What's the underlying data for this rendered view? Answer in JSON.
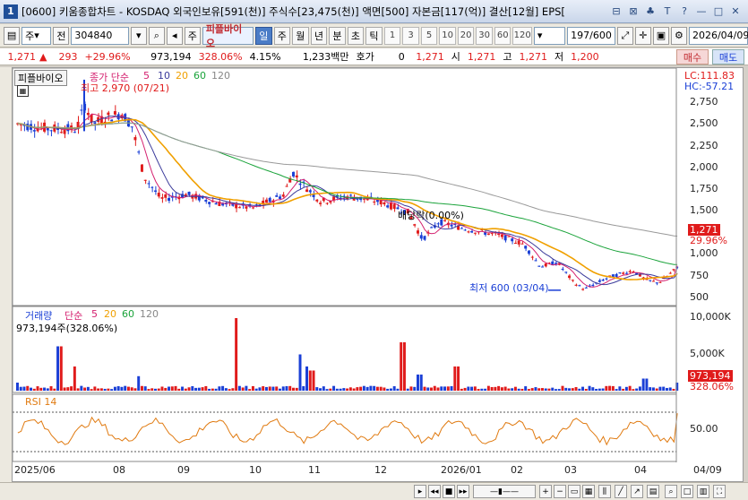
{
  "window": {
    "number": "1",
    "title": "[0600] 키움종합차트 - KOSDAQ 외국인보유[591(천)] 주식수[23,475(천)] 액면[500] 자본금[117(억)] 결산[12월] EPS[",
    "controls": [
      "⊟",
      "⊠",
      "♣",
      "T",
      "?",
      "—",
      "□",
      "✕"
    ]
  },
  "toolbar": {
    "market": "주",
    "prev": "전",
    "code": "304840",
    "name": "피플바이오",
    "icon_left": "◂▸",
    "label_jong": "주",
    "periods": [
      "일",
      "주",
      "월",
      "년",
      "분",
      "초",
      "틱"
    ],
    "active_period": "일",
    "numbers": [
      "1",
      "3",
      "5",
      "10",
      "20",
      "30",
      "60",
      "120"
    ],
    "count": "197/600",
    "date": "2026/04/09"
  },
  "pricebar": {
    "price": "1,271",
    "change_arrow": "▲",
    "change": "293",
    "change_pct": "+29.96%",
    "volume": "973,194",
    "volume_pct": "328.06%",
    "turnover": "4.15%",
    "amount": "1,233백만",
    "hoga_label": "호가",
    "hoga_value": "0",
    "ask": "1,271",
    "open_label": "시",
    "open": "1,271",
    "high_label": "고",
    "high": "1,271",
    "low_label": "저",
    "low": "1,200",
    "buy": "매수",
    "sell": "매도"
  },
  "price_panel": {
    "title": "피플바이오",
    "ma_label": "종가 단순",
    "ma_periods": [
      "5",
      "10",
      "20",
      "60",
      "120"
    ],
    "lc": "LC:111.83",
    "hc": "HC:-57.21",
    "max_note": "최고 2,970 (07/21)",
    "min_note": "최저 600 (03/04)",
    "dividend_note": "배당락(0.00%)",
    "current_label": "1,271",
    "current_pct": "29.96%",
    "y_ticks": [
      "2,750",
      "2,500",
      "2,250",
      "2,000",
      "1,750",
      "1,500",
      "1,271",
      "1,000",
      "750",
      "500"
    ]
  },
  "volume_panel": {
    "title": "거래량",
    "ma_label": "단순",
    "ma_periods": [
      "5",
      "20",
      "60",
      "120"
    ],
    "value_text": "973,194주(328.06%)",
    "y_ticks": [
      "10,000K",
      "5,000K"
    ],
    "current_label": "973,194",
    "current_pct": "328.06%"
  },
  "rsi_panel": {
    "title": "RSI 14",
    "y_tick": "50.00"
  },
  "x_axis": [
    "2025/06",
    "08",
    "09",
    "10",
    "11",
    "12",
    "2026/01",
    "02",
    "03",
    "04",
    "04/09"
  ],
  "colors": {
    "up": "#e01b1b",
    "down": "#1a3fd6",
    "ma5": "#d4206f",
    "ma10": "#3b3b9b",
    "ma20": "#f0a000",
    "ma60": "#1aa33a",
    "ma120": "#999999",
    "rsi": "#e07a10"
  }
}
